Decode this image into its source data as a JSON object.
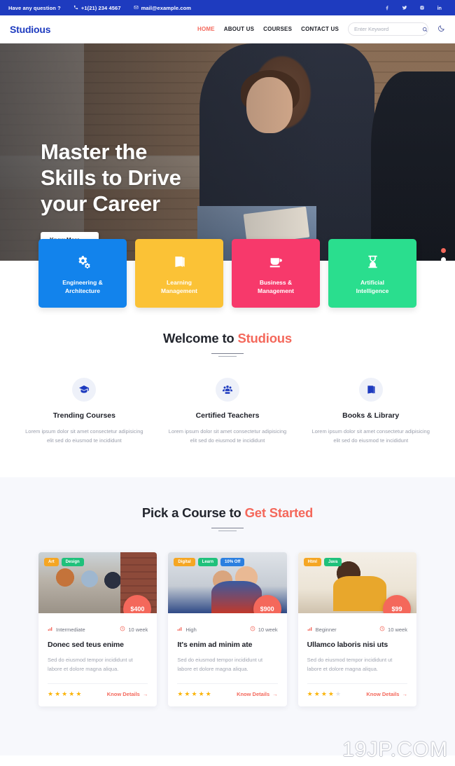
{
  "topbar": {
    "question": "Have any question ?",
    "phone": "+1(21) 234 4567",
    "email": "mail@example.com",
    "socials": [
      {
        "name": "facebook-icon"
      },
      {
        "name": "twitter-icon"
      },
      {
        "name": "instagram-icon"
      },
      {
        "name": "linkedin-icon"
      }
    ],
    "bg_color": "#1e3bbf"
  },
  "nav": {
    "logo": "Studious",
    "links": [
      {
        "label": "HOME",
        "active": true
      },
      {
        "label": "ABOUT US",
        "active": false
      },
      {
        "label": "COURSES",
        "active": false
      },
      {
        "label": "CONTACT US",
        "active": false
      }
    ],
    "search_placeholder": "Enter Keyword",
    "search_value": "",
    "accent_color": "#f4685b",
    "logo_color": "#1e3bbf"
  },
  "hero": {
    "title_line1": "Master the",
    "title_line2": "Skills to Drive",
    "title_line3": "your Career",
    "cta_label": "Know More",
    "cta_arrow": "→",
    "slides": [
      {
        "active": true
      },
      {
        "active": false
      }
    ]
  },
  "categories": [
    {
      "label_line1": "Engineering &",
      "label_line2": "Architecture",
      "color": "#1283ec",
      "icon": "gears-icon"
    },
    {
      "label_line1": "Learning",
      "label_line2": "Management",
      "color": "#fbc236",
      "icon": "book-icon"
    },
    {
      "label_line1": "Business &",
      "label_line2": "Management",
      "color": "#f7396b",
      "icon": "coffee-cup-icon"
    },
    {
      "label_line1": "Artificial",
      "label_line2": "Intelligence",
      "color": "#2ade8e",
      "icon": "hourglass-icon"
    }
  ],
  "welcome": {
    "title_plain": "Welcome to ",
    "title_accent": "Studious",
    "features": [
      {
        "icon": "graduation-cap-icon",
        "title": "Trending Courses",
        "text": "Lorem ipsum dolor sit amet consectetur adipisicing elit sed do eiusmod te incididunt"
      },
      {
        "icon": "people-group-icon",
        "title": "Certified Teachers",
        "text": "Lorem ipsum dolor sit amet consectetur adipisicing elit sed do eiusmod te incididunt"
      },
      {
        "icon": "book-open-icon",
        "title": "Books & Library",
        "text": "Lorem ipsum dolor sit amet consectetur adipisicing elit sed do eiusmod te incididunt"
      }
    ]
  },
  "courses_section": {
    "title_plain": "Pick a Course to ",
    "title_accent": "Get Started",
    "cards": [
      {
        "tags": [
          {
            "label": "Art",
            "color": "#f5a623"
          },
          {
            "label": "Design",
            "color": "#1fc17b"
          }
        ],
        "price": "$400",
        "level": "Intermediate",
        "duration": "10 week",
        "title": "Donec sed teus enime",
        "desc": "Sed do eiusmod tempor incididunt ut labore et dolore magna aliqua.",
        "rating": 5,
        "link_label": "Know Details",
        "link_arrow": "→"
      },
      {
        "tags": [
          {
            "label": "Digital",
            "color": "#f5a623"
          },
          {
            "label": "Learn",
            "color": "#1fc17b"
          },
          {
            "label": "10% Off",
            "color": "#2b7fe0"
          }
        ],
        "price": "$900",
        "level": "High",
        "duration": "10 week",
        "title": "It's enim ad minim ate",
        "desc": "Sed do eiusmod tempor incididunt ut labore et dolore magna aliqua.",
        "rating": 5,
        "link_label": "Know Details",
        "link_arrow": "→"
      },
      {
        "tags": [
          {
            "label": "Html",
            "color": "#f5a623"
          },
          {
            "label": "Java",
            "color": "#1fc17b"
          }
        ],
        "price": "$99",
        "level": "Beginner",
        "duration": "10 week",
        "title": "Ullamco laboris nisi uts",
        "desc": "Sed do eiusmod tempor incididunt ut labore et dolore magna aliqua.",
        "rating": 4,
        "link_label": "Know Details",
        "link_arrow": "→"
      }
    ]
  },
  "watermark": "19JP.COM"
}
